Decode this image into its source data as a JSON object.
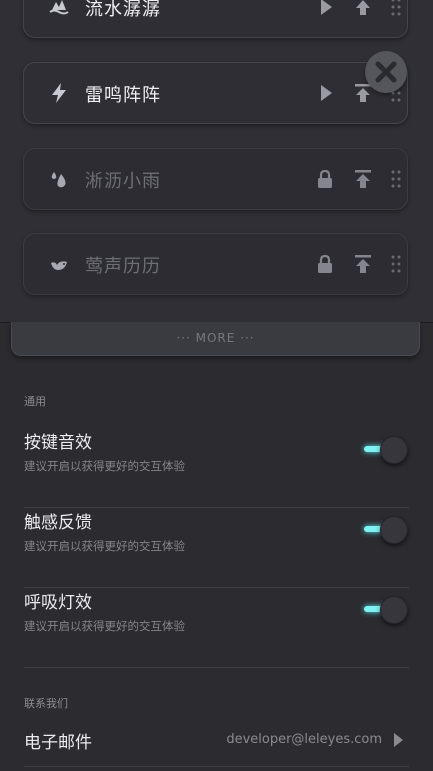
{
  "sounds": [
    {
      "name": "流水潺潺",
      "icon": "water-icon",
      "locked": false
    },
    {
      "name": "雷鸣阵阵",
      "icon": "lightning-icon",
      "locked": false
    },
    {
      "name": "淅沥小雨",
      "icon": "rain-drops-icon",
      "locked": true
    },
    {
      "name": "莺声历历",
      "icon": "bird-icon",
      "locked": true
    }
  ],
  "more": {
    "label": "··· MORE ···"
  },
  "general": {
    "title": "通用",
    "settings": [
      {
        "title": "按键音效",
        "subtitle": "建议开启以获得更好的交互体验",
        "enabled": true
      },
      {
        "title": "触感反馈",
        "subtitle": "建议开启以获得更好的交互体验",
        "enabled": true
      },
      {
        "title": "呼吸灯效",
        "subtitle": "建议开启以获得更好的交互体验",
        "enabled": true
      }
    ]
  },
  "contact": {
    "title": "联系我们",
    "email_label": "电子邮件",
    "email_value": "developer@leleyes.com"
  },
  "colors": {
    "accent": "#7ff2f2",
    "background": "#2b2b30"
  }
}
